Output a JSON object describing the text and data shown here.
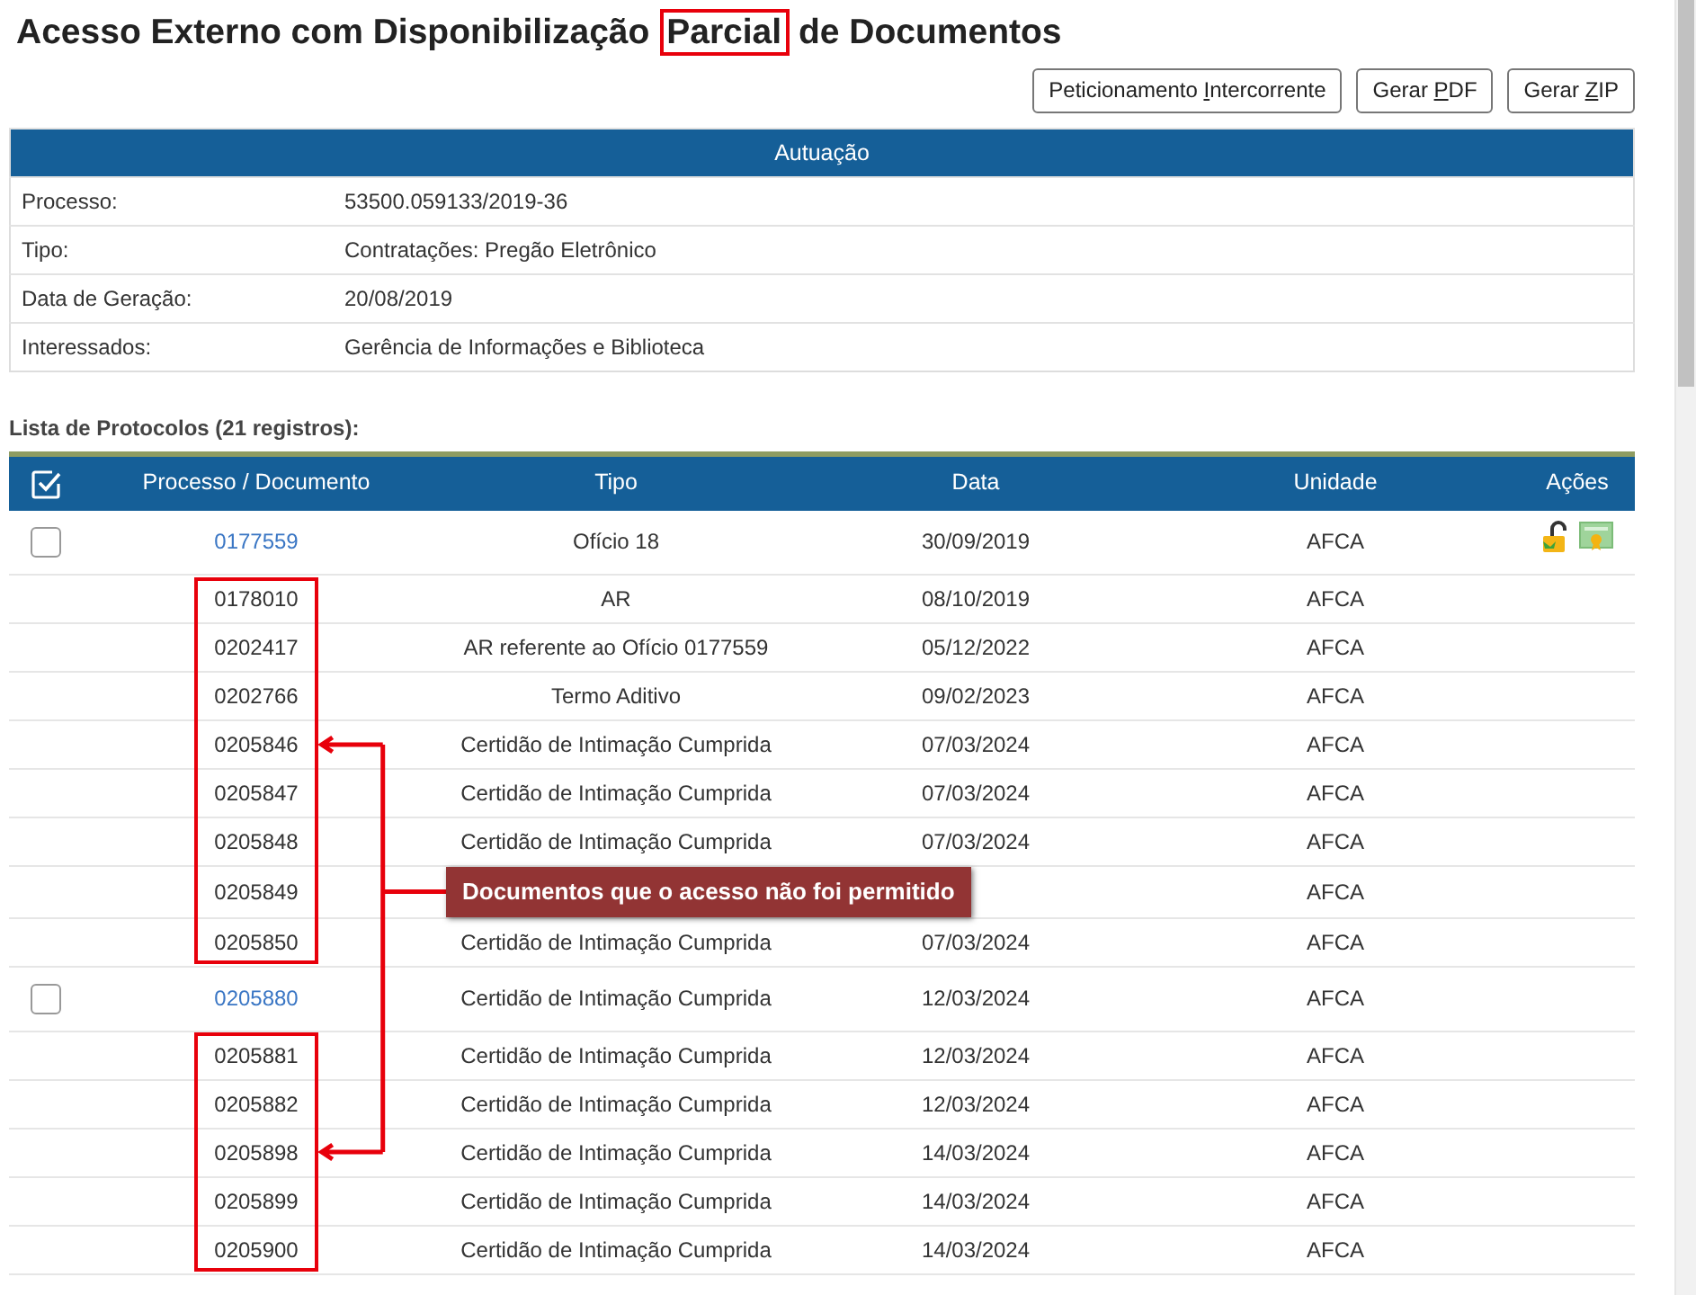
{
  "title": {
    "before": "Acesso Externo com Disponibilização ",
    "boxed": "Parcial",
    "after": " de Documentos"
  },
  "buttons": [
    {
      "before": "Peticionamento ",
      "key": "I",
      "after": "ntercorrente"
    },
    {
      "before": "Gerar ",
      "key": "P",
      "after": "DF"
    },
    {
      "before": "Gerar ",
      "key": "Z",
      "after": "IP"
    }
  ],
  "autuacao": {
    "title": "Autuação",
    "fields": [
      {
        "label": "Processo:",
        "value": "53500.059133/2019-36"
      },
      {
        "label": "Tipo:",
        "value": "Contratações: Pregão Eletrônico"
      },
      {
        "label": "Data de Geração:",
        "value": "20/08/2019"
      },
      {
        "label": "Interessados:",
        "value": "Gerência de Informações e Biblioteca"
      }
    ]
  },
  "list_title": "Lista de Protocolos (21 registros):",
  "table": {
    "columns": [
      "Processo / Documento",
      "Tipo",
      "Data",
      "Unidade",
      "Ações"
    ],
    "rows": [
      {
        "kind": "process",
        "checked": false,
        "number": "0177559",
        "tipo": "Ofício 18",
        "data": "30/09/2019",
        "unidade": "AFCA",
        "actions": true,
        "restricted": false,
        "arrow_target": false
      },
      {
        "kind": "document",
        "number": "0178010",
        "tipo": "AR",
        "data": "08/10/2019",
        "unidade": "AFCA",
        "restricted": true,
        "arrow_target": false
      },
      {
        "kind": "document",
        "number": "0202417",
        "tipo": "AR referente ao Ofício 0177559",
        "data": "05/12/2022",
        "unidade": "AFCA",
        "restricted": true,
        "arrow_target": false
      },
      {
        "kind": "document",
        "number": "0202766",
        "tipo": "Termo Aditivo",
        "data": "09/02/2023",
        "unidade": "AFCA",
        "restricted": true,
        "arrow_target": false
      },
      {
        "kind": "document",
        "number": "0205846",
        "tipo": "Certidão de Intimação Cumprida",
        "data": "07/03/2024",
        "unidade": "AFCA",
        "restricted": true,
        "arrow_target": true
      },
      {
        "kind": "document",
        "number": "0205847",
        "tipo": "Certidão de Intimação Cumprida",
        "data": "07/03/2024",
        "unidade": "AFCA",
        "restricted": true,
        "arrow_target": false
      },
      {
        "kind": "document",
        "number": "0205848",
        "tipo": "Certidão de Intimação Cumprida",
        "data": "07/03/2024",
        "unidade": "AFCA",
        "restricted": true,
        "arrow_target": false
      },
      {
        "kind": "document",
        "number": "0205849",
        "callout": "Documentos que o acesso não foi permitido",
        "unidade": "AFCA",
        "restricted": true,
        "arrow_target": false
      },
      {
        "kind": "document",
        "number": "0205850",
        "tipo": "Certidão de Intimação Cumprida",
        "data": "07/03/2024",
        "unidade": "AFCA",
        "restricted": true,
        "arrow_target": false
      },
      {
        "kind": "process",
        "checked": false,
        "number": "0205880",
        "tipo": "Certidão de Intimação Cumprida",
        "data": "12/03/2024",
        "unidade": "AFCA",
        "actions": false,
        "restricted": false,
        "arrow_target": false
      },
      {
        "kind": "document",
        "number": "0205881",
        "tipo": "Certidão de Intimação Cumprida",
        "data": "12/03/2024",
        "unidade": "AFCA",
        "restricted": true,
        "arrow_target": false
      },
      {
        "kind": "document",
        "number": "0205882",
        "tipo": "Certidão de Intimação Cumprida",
        "data": "12/03/2024",
        "unidade": "AFCA",
        "restricted": true,
        "arrow_target": false
      },
      {
        "kind": "document",
        "number": "0205898",
        "tipo": "Certidão de Intimação Cumprida",
        "data": "14/03/2024",
        "unidade": "AFCA",
        "restricted": true,
        "arrow_target": true
      },
      {
        "kind": "document",
        "number": "0205899",
        "tipo": "Certidão de Intimação Cumprida",
        "data": "14/03/2024",
        "unidade": "AFCA",
        "restricted": true,
        "arrow_target": false
      },
      {
        "kind": "document",
        "number": "0205900",
        "tipo": "Certidão de Intimação Cumprida",
        "data": "14/03/2024",
        "unidade": "AFCA",
        "restricted": true,
        "arrow_target": false
      }
    ]
  }
}
